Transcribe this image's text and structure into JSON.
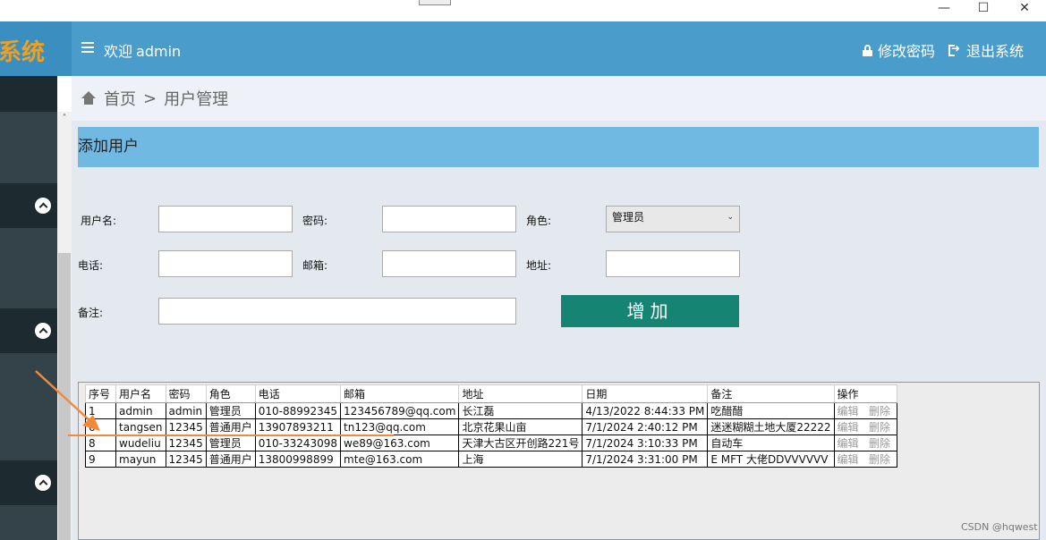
{
  "window": {
    "minimize": "—",
    "maximize": "☐",
    "close": "✕"
  },
  "brand": {
    "text": "系统",
    "color": "#f0a020"
  },
  "header": {
    "welcome_prefix": "欢迎",
    "username": "admin",
    "change_password": "修改密码",
    "logout": "退出系统"
  },
  "breadcrumb": {
    "home": "首页",
    "separator": ">",
    "current": "用户管理"
  },
  "form": {
    "title": "添加用户",
    "username_label": "用户名:",
    "username_value": "",
    "password_label": "密码:",
    "password_value": "",
    "role_label": "角色:",
    "role_selected": "管理员",
    "phone_label": "电话:",
    "phone_value": "",
    "email_label": "邮箱:",
    "email_value": "",
    "address_label": "地址:",
    "address_value": "",
    "remark_label": "备注:",
    "remark_value": "",
    "add_button": "增加"
  },
  "table": {
    "columns": [
      "序号",
      "用户名",
      "密码",
      "角色",
      "电话",
      "邮箱",
      "地址",
      "日期",
      "备注",
      "操作"
    ],
    "rows": [
      {
        "id": "1",
        "username": "admin",
        "password": "admin",
        "role": "管理员",
        "phone": "010-88992345",
        "email": "123456789@qq.com",
        "address": "长江磊",
        "date": "4/13/2022 8:44:33 PM",
        "remark": "吃醋醋",
        "edit": "编辑",
        "delete": "删除"
      },
      {
        "id": "6",
        "username": "tangsen",
        "password": "12345",
        "role": "普通用户",
        "phone": "13907893211",
        "email": "tn123@qq.com",
        "address": "北京花果山亩",
        "date": "7/1/2024 2:40:12 PM",
        "remark": "迷迷糊糊土地大厦22222",
        "edit": "编辑",
        "delete": "删除"
      },
      {
        "id": "8",
        "username": "wudeliu",
        "password": "12345",
        "role": "管理员",
        "phone": "010-33243098",
        "email": "we89@163.com",
        "address": "天津大古区开创路221号",
        "date": "7/1/2024 3:10:33 PM",
        "remark": "自动车",
        "edit": "编辑",
        "delete": "删除"
      },
      {
        "id": "9",
        "username": "mayun",
        "password": "12345",
        "role": "普通用户",
        "phone": "13800998899",
        "email": "mte@163.com",
        "address": "上海",
        "date": "7/1/2024 3:31:00 PM",
        "remark": "E MFT 大佬DDVVVVVV",
        "edit": "编辑",
        "delete": "删除"
      }
    ]
  },
  "watermark": "CSDN @hqwest",
  "colors": {
    "topbar": "#4a9ccb",
    "section_header": "#70b9e3",
    "add_button": "#158473",
    "sidebar": "#2b3a42",
    "arrow": "#f08a3a"
  }
}
